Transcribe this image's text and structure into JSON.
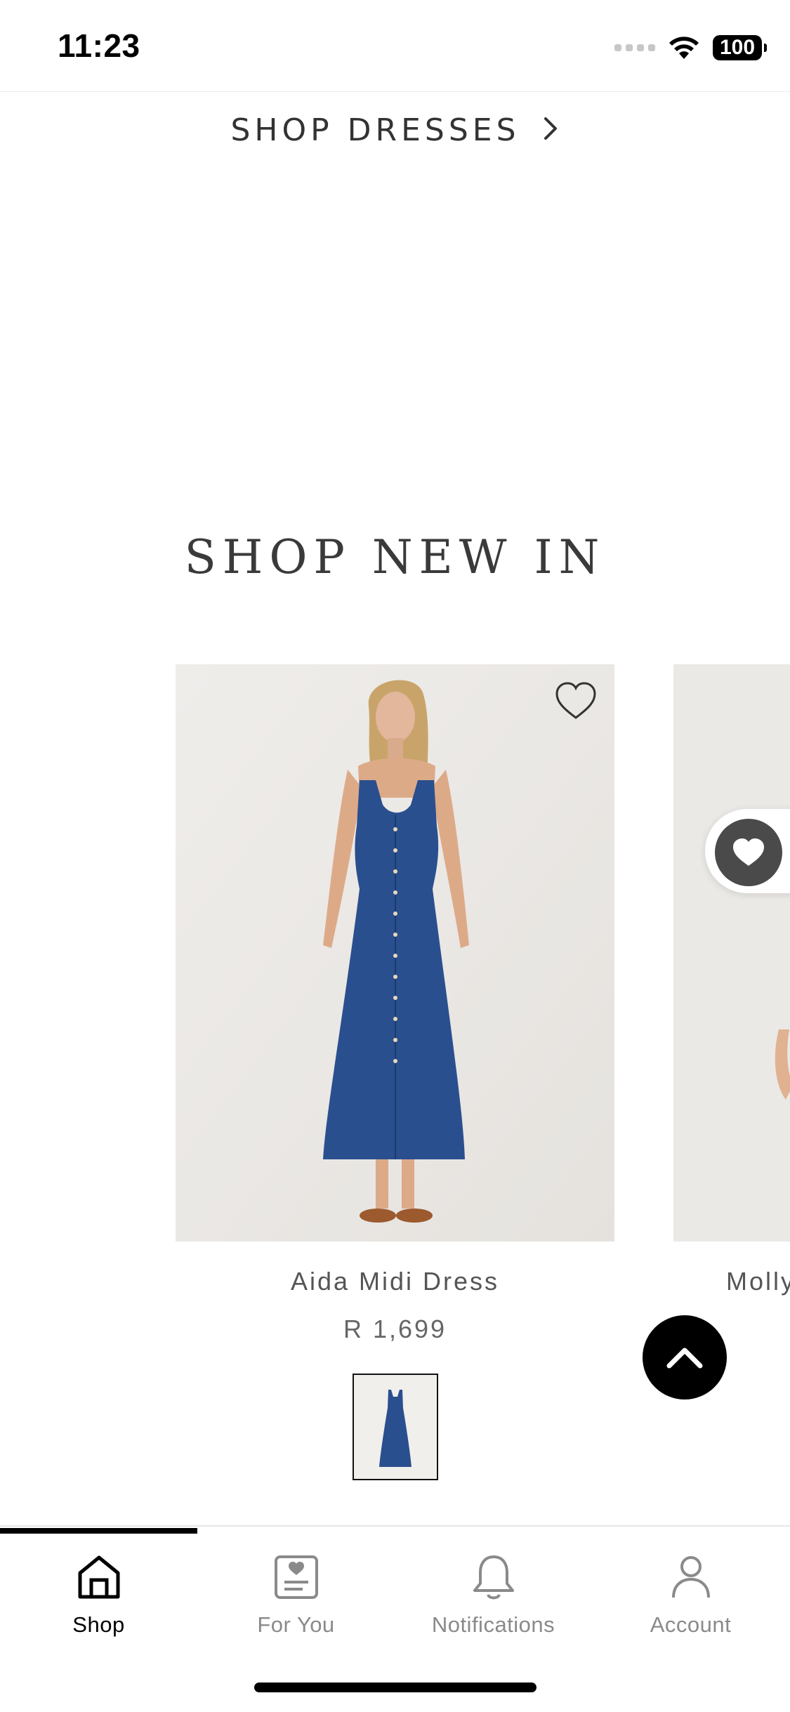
{
  "status_bar": {
    "time": "11:23",
    "battery": "100"
  },
  "links": {
    "shop_dresses": "SHOP DRESSES"
  },
  "sections": {
    "new_in_title": "SHOP NEW IN"
  },
  "products": [
    {
      "name": "Aida Midi Dress",
      "price": "R 1,699"
    },
    {
      "name": "Molly"
    }
  ],
  "tabs": [
    {
      "label": "Shop",
      "icon": "home-icon",
      "active": true
    },
    {
      "label": "For You",
      "icon": "for-you-icon",
      "active": false
    },
    {
      "label": "Notifications",
      "icon": "bell-icon",
      "active": false
    },
    {
      "label": "Account",
      "icon": "account-icon",
      "active": false
    }
  ],
  "colors": {
    "accent": "#000000",
    "inactive_tab": "#8a8a8a",
    "image_bg": "#ebe9e6",
    "dress_blue": "#2a4f8e"
  }
}
